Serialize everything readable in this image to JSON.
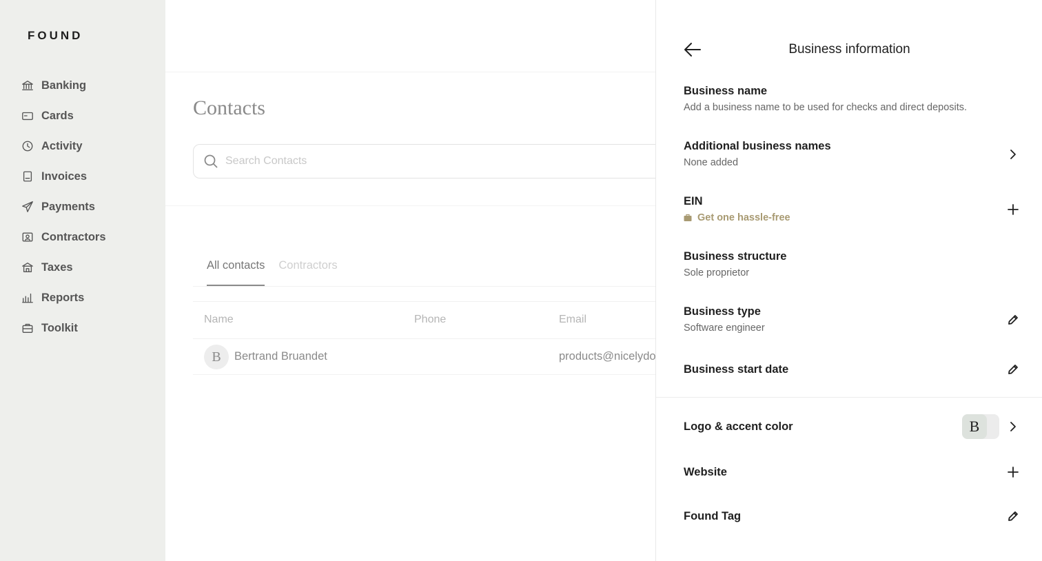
{
  "brand": "FOUND",
  "sidebar": {
    "items": [
      {
        "label": "Banking",
        "icon": "bank-icon"
      },
      {
        "label": "Cards",
        "icon": "card-icon"
      },
      {
        "label": "Activity",
        "icon": "clock-icon"
      },
      {
        "label": "Invoices",
        "icon": "invoice-icon"
      },
      {
        "label": "Payments",
        "icon": "send-icon"
      },
      {
        "label": "Contractors",
        "icon": "contractor-icon"
      },
      {
        "label": "Taxes",
        "icon": "tax-icon"
      },
      {
        "label": "Reports",
        "icon": "bar-chart-icon"
      },
      {
        "label": "Toolkit",
        "icon": "toolkit-icon"
      }
    ]
  },
  "main": {
    "title": "Contacts",
    "search_placeholder": "Search Contacts",
    "tabs": [
      {
        "label": "All contacts",
        "active": true
      },
      {
        "label": "Contractors",
        "active": false
      }
    ],
    "columns": [
      "Name",
      "Phone",
      "Email"
    ],
    "rows": [
      {
        "initial": "B",
        "name": "Bertrand Bruandet",
        "phone": "",
        "email": "products@nicelydon"
      }
    ]
  },
  "panel": {
    "title": "Business information",
    "items": [
      {
        "title": "Business name",
        "subtitle": "Add a business name to be used for checks and direct deposits.",
        "action": "none"
      },
      {
        "title": "Additional business names",
        "subtitle": "None added",
        "action": "chevron-right-icon"
      },
      {
        "title": "EIN",
        "subtitle": "Get one hassle-free",
        "action": "plus-icon"
      },
      {
        "title": "Business structure",
        "subtitle": "Sole proprietor",
        "action": "none"
      },
      {
        "title": "Business type",
        "subtitle": "Software engineer",
        "action": "pencil-icon"
      },
      {
        "title": "Business start date",
        "subtitle": "",
        "action": "pencil-icon"
      },
      {
        "title": "Logo & accent color",
        "subtitle": "",
        "action": "chevron-right-icon",
        "logo_initial": "B"
      },
      {
        "title": "Website",
        "subtitle": "",
        "action": "plus-icon"
      },
      {
        "title": "Found Tag",
        "subtitle": "",
        "action": "pencil-icon"
      }
    ],
    "accent_color": "#a89a72"
  }
}
